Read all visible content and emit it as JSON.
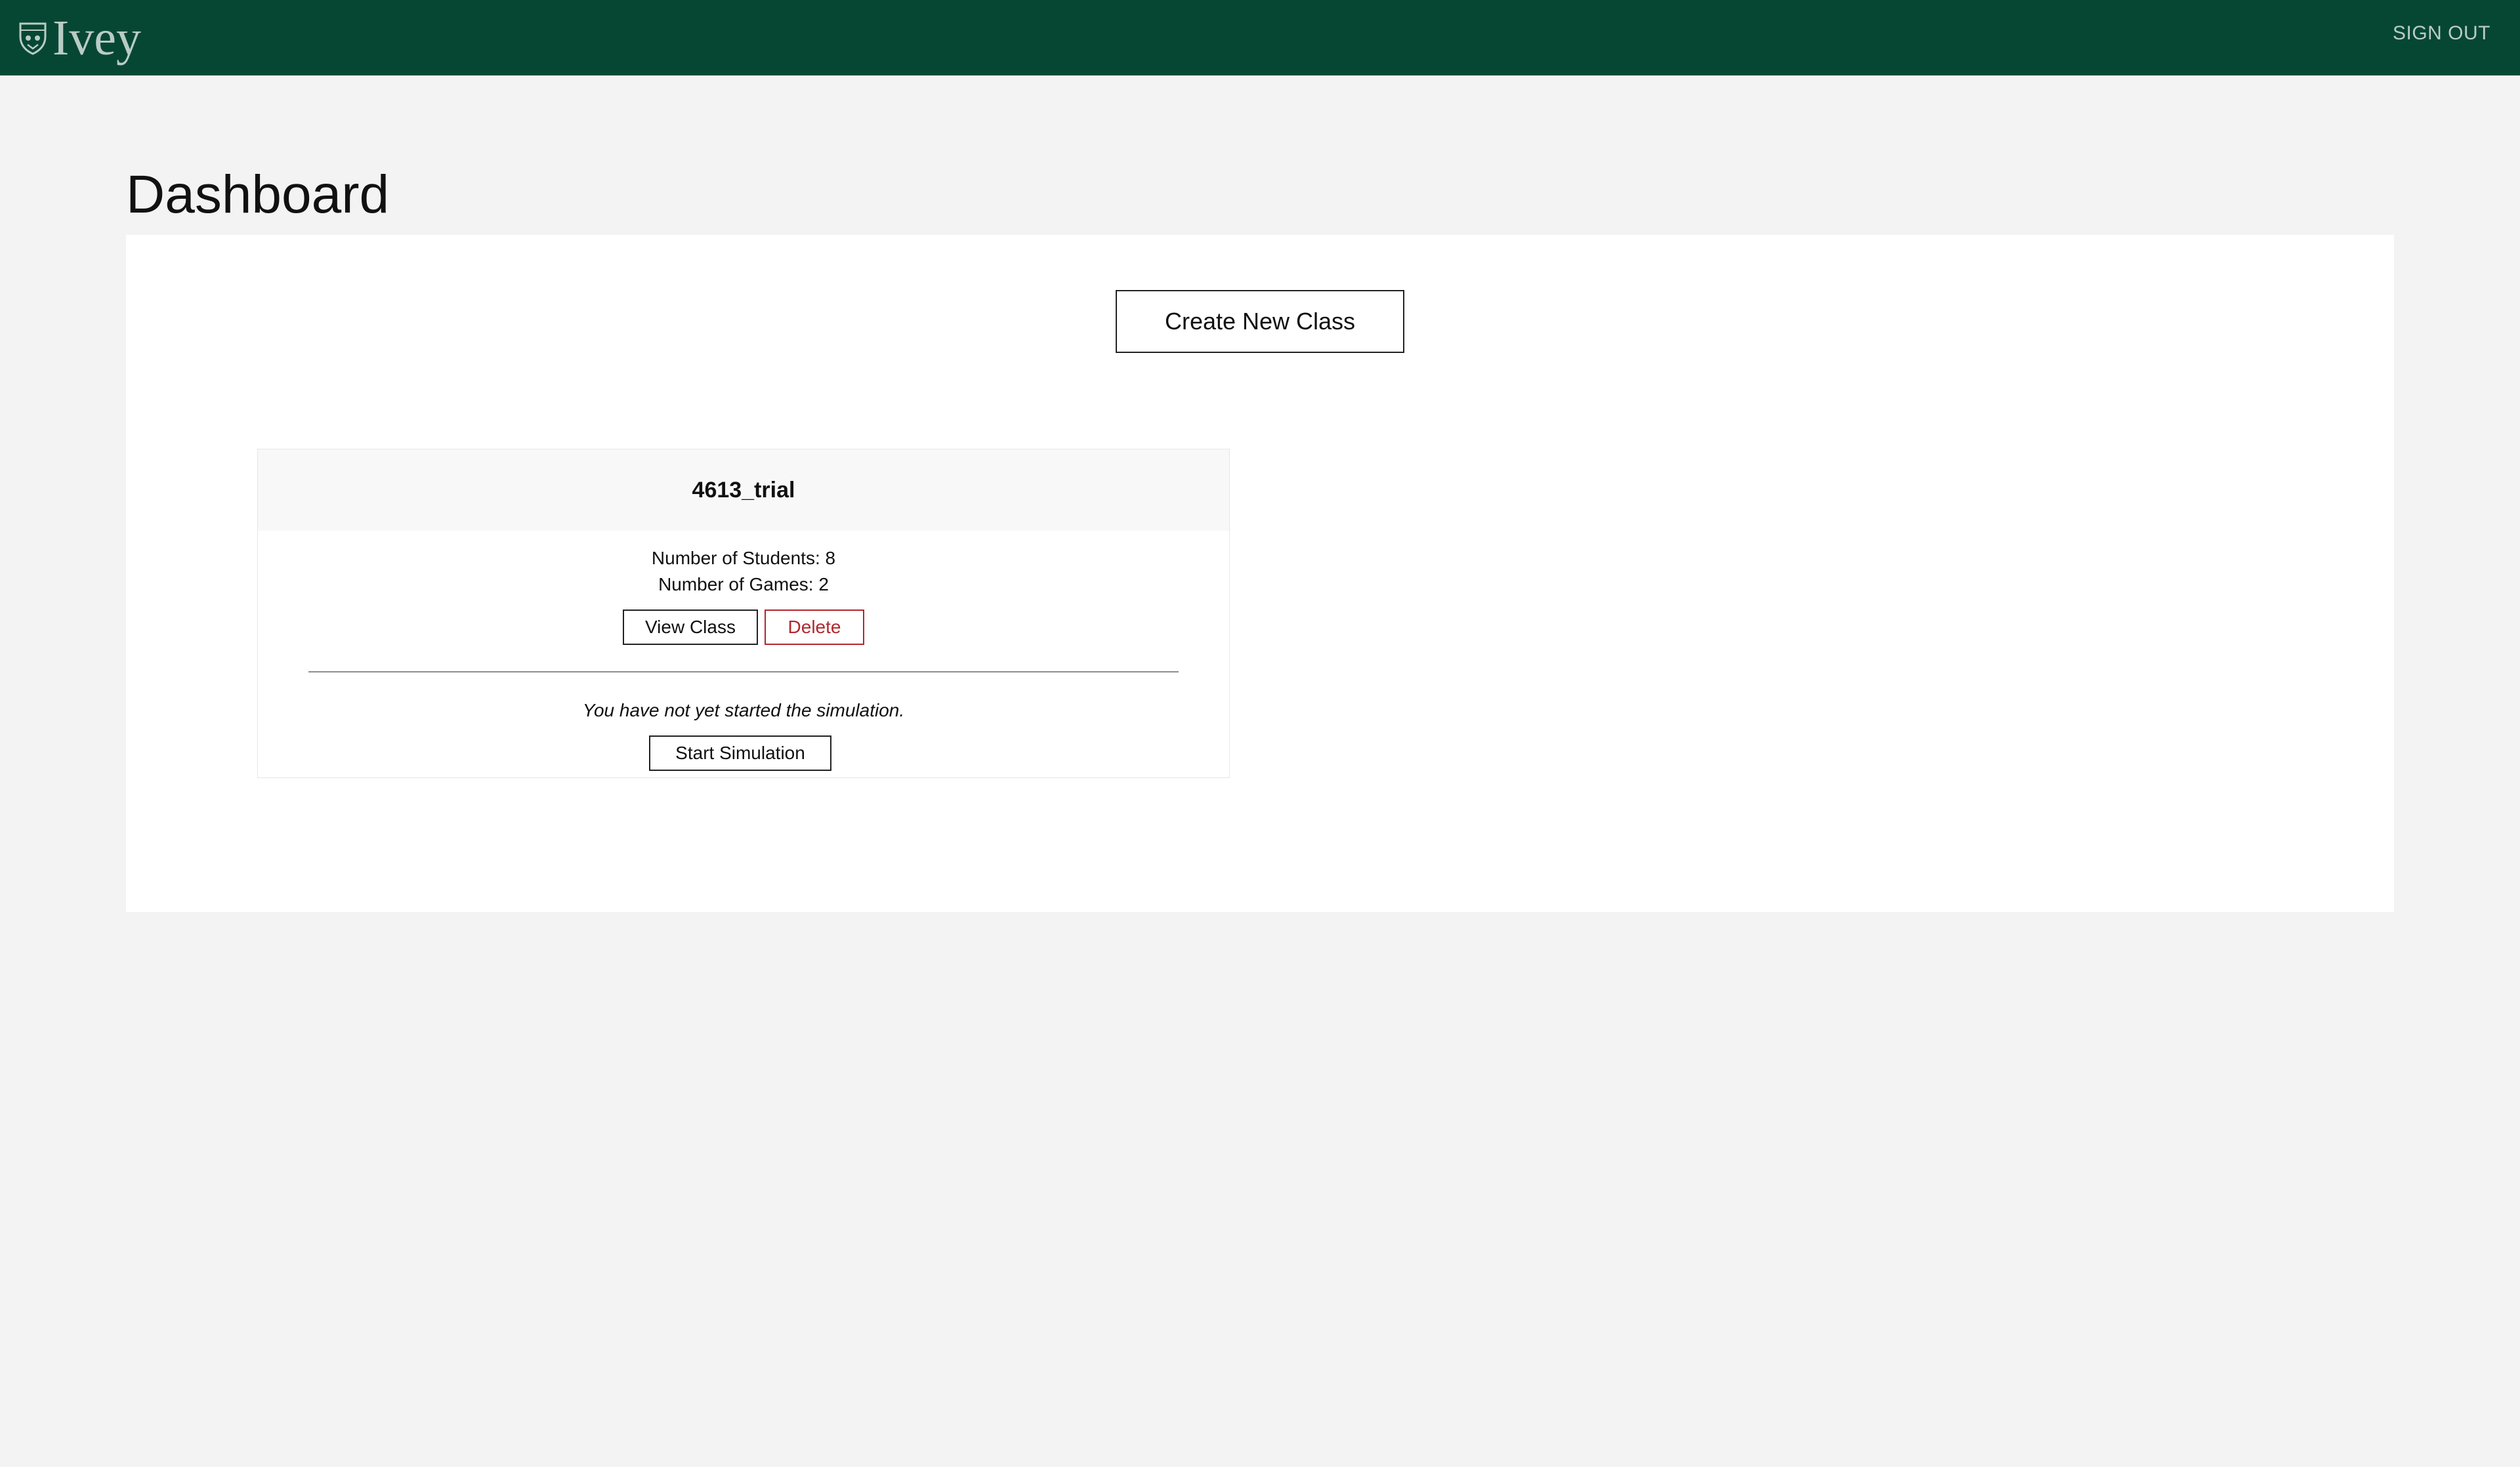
{
  "header": {
    "logo_text": "Ivey",
    "sign_out_label": "SIGN OUT",
    "bar_color": "#064734"
  },
  "page": {
    "title": "Dashboard"
  },
  "actions": {
    "create_class_label": "Create New Class"
  },
  "classes": [
    {
      "name": "4613_trial",
      "students_line": "Number of Students: 8",
      "games_line": "Number of Games: 2",
      "view_label": "View Class",
      "delete_label": "Delete",
      "simulation_status": "You have not yet started the simulation.",
      "start_label": "Start Simulation"
    }
  ],
  "icons": {
    "logo_crest": "shield-crest-icon"
  },
  "colors": {
    "accent": "#064734",
    "danger": "#b0282e",
    "background": "#f2f3f2"
  }
}
